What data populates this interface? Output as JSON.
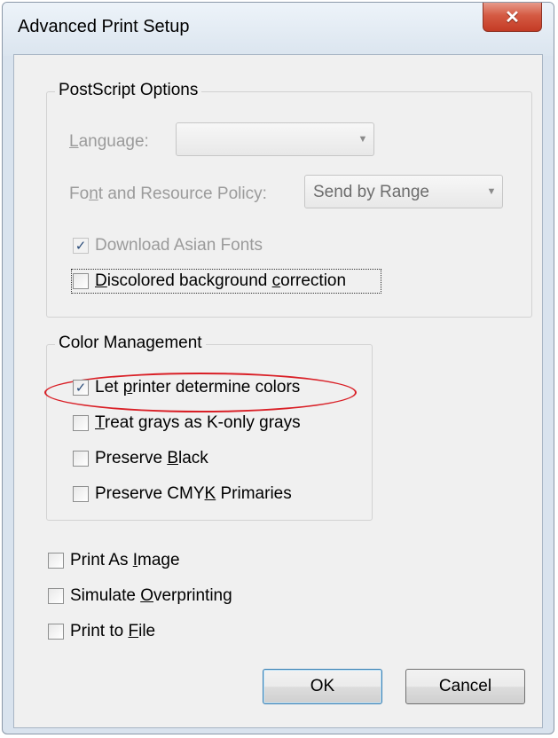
{
  "window": {
    "title": "Advanced Print Setup",
    "close_glyph": "✕"
  },
  "postscript": {
    "legend": "PostScript Options",
    "language_label": "Language:",
    "language_value": "",
    "font_policy_label": "Font and Resource Policy:",
    "font_policy_value": "Send by Range",
    "download_asian_fonts_label": "Download Asian Fonts",
    "download_asian_fonts_checked": true,
    "discolored_label": "Discolored background correction",
    "discolored_checked": false
  },
  "color_management": {
    "legend": "Color Management",
    "let_printer_label": "Let printer determine colors",
    "let_printer_checked": true,
    "treat_grays_label": "Treat grays as K-only grays",
    "preserve_black_label": "Preserve Black",
    "preserve_cmyk_label": "Preserve CMYK Primaries"
  },
  "options": {
    "print_as_image_label": "Print As Image",
    "simulate_overprinting_label": "Simulate Overprinting",
    "print_to_file_label": "Print to File"
  },
  "buttons": {
    "ok": "OK",
    "cancel": "Cancel"
  },
  "colors": {
    "highlight_ellipse": "#d91f26",
    "close_button": "#c43b25"
  }
}
